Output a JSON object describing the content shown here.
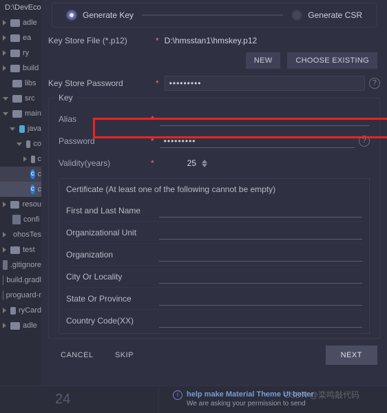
{
  "tree": {
    "root": "D:\\DevEco",
    "items": [
      {
        "label": "adle"
      },
      {
        "label": "ea"
      },
      {
        "label": "ry"
      },
      {
        "label": "build"
      },
      {
        "label": "libs"
      },
      {
        "label": "src"
      },
      {
        "label": "main",
        "open": true
      },
      {
        "label": "java",
        "open": true
      },
      {
        "label": "co",
        "open": true
      },
      {
        "label": "c",
        "file": false
      },
      {
        "label": "c",
        "cls": true,
        "sel": true
      },
      {
        "label": "c",
        "cls": true,
        "sel2": true
      },
      {
        "label": "resou"
      },
      {
        "label": "confi",
        "file": true
      },
      {
        "label": "ohosTes"
      },
      {
        "label": "test"
      },
      {
        "label": ".gitignore",
        "file": true
      },
      {
        "label": "build.gradl",
        "file": true
      },
      {
        "label": "proguard-r",
        "file": true
      },
      {
        "label": "ryCard"
      },
      {
        "label": "adle"
      }
    ]
  },
  "steps": {
    "active": "Generate Key",
    "inactive": "Generate CSR"
  },
  "keystore": {
    "file_label": "Key Store File (*.p12)",
    "file_value": "D:\\hmsstan1\\hmskey.p12",
    "btn_new": "NEW",
    "btn_choose": "CHOOSE EXISTING",
    "password_label": "Key Store Password",
    "password_value": "•••••••••"
  },
  "key_section": {
    "legend": "Key",
    "alias_label": "Alias",
    "alias_value": "",
    "password_label": "Password",
    "password_value": "•••••••••",
    "validity_label": "Validity(years)",
    "validity_value": "25"
  },
  "cert": {
    "title": "Certificate (At least one of the following cannot be empty)",
    "rows": [
      "First and Last Name",
      "Organizational Unit",
      "Organization",
      "City Or Locality",
      "State Or Province",
      "Country Code(XX)"
    ]
  },
  "buttons": {
    "cancel": "CANCEL",
    "skip": "SKIP",
    "next": "NEXT"
  },
  "status": {
    "num": "24",
    "title": "help make Material Theme UI better",
    "sub": "We are asking your permission to send"
  },
  "watermark": "CSDN @栾鸣敲代码",
  "help_glyph": "?"
}
